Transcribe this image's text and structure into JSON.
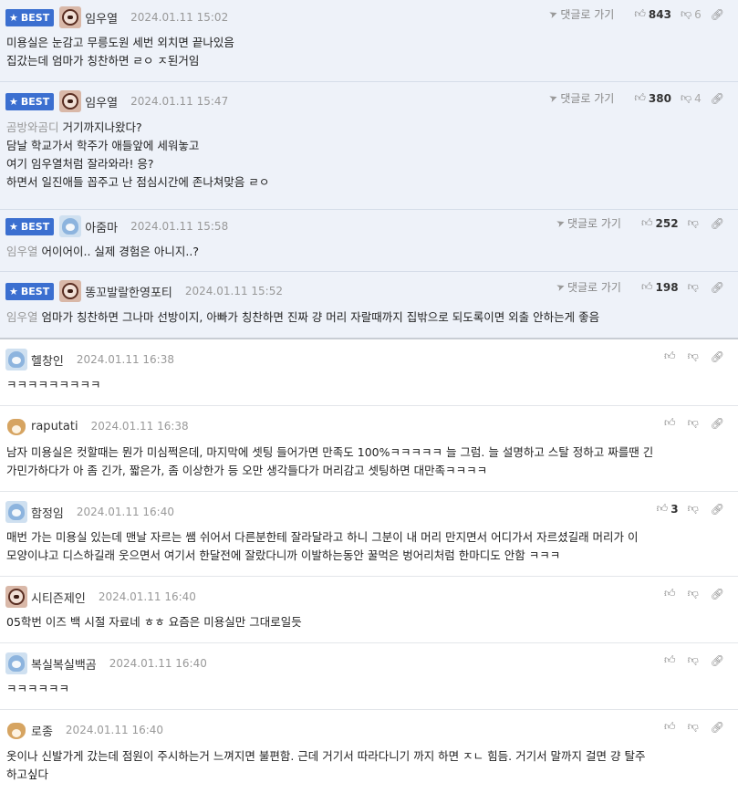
{
  "labels": {
    "best": "BEST",
    "reply": "댓글로 가기"
  },
  "comments": [
    {
      "nick": "임우열",
      "date": "2024.01.11 15:02",
      "up": "843",
      "down": "6",
      "lines": [
        "미용실은 눈감고 무릉도원 세번 외치면 끝나있음",
        "집갔는데 엄마가 칭찬하면 ㄹㅇ ㅈ된거임"
      ]
    },
    {
      "nick": "임우열",
      "date": "2024.01.11 15:47",
      "up": "380",
      "down": "4",
      "mention": "곰방와곰디",
      "lines": [
        "거기까지나왔다?",
        "담날 학교가서 학주가 애들앞에 세워놓고",
        "여기 임우열처럼 잘라와라! 응?",
        "하면서 일진애들 꼽주고 난 점심시간에 존나쳐맞음 ㄹㅇ"
      ]
    },
    {
      "nick": "아줌마",
      "date": "2024.01.11 15:58",
      "up": "252",
      "mention": "임우열",
      "lines": [
        "어이어이.. 실제 경험은 아니지..?"
      ]
    },
    {
      "nick": "똥꼬발랄한영포티",
      "date": "2024.01.11 15:52",
      "up": "198",
      "mention": "임우열",
      "lines": [
        "엄마가 칭찬하면 그나마 선방이지, 아빠가 칭찬하면 진짜 걍 머리 자랄때까지 집밖으로 되도록이면 외출 안하는게 좋음"
      ]
    },
    {
      "nick": "헬창인",
      "date": "2024.01.11 16:38",
      "lines": [
        "ㅋㅋㅋㅋㅋㅋㅋㅋㅋ"
      ]
    },
    {
      "nick": "raputati",
      "date": "2024.01.11 16:38",
      "lines": [
        "남자 미용실은 컷할때는 뭔가 미심쩍은데, 마지막에 셋팅 들어가면 만족도 100%ㅋㅋㅋㅋㅋ 늘 그럼. 늘 설명하고 스탈 정하고 짜를땐 긴",
        "가민가하다가 아 좀 긴가, 짧은가, 좀 이상한가 등 오만 생각들다가 머리감고 셋팅하면 대만족ㅋㅋㅋㅋ"
      ]
    },
    {
      "nick": "함정임",
      "date": "2024.01.11 16:40",
      "up": "3",
      "lines": [
        "매번 가는 미용실 있는데 맨날 자르는 쌤 쉬어서 다른분한테 잘라달라고 하니 그분이 내 머리 만지면서 어디가서 자르셨길래 머리가 이",
        "모양이냐고 디스하길래 웃으면서 여기서 한달전에 잘랐다니까 이발하는동안 꿀먹은 벙어리처럼 한마디도 안함 ㅋㅋㅋ"
      ]
    },
    {
      "nick": "시티즌제인",
      "date": "2024.01.11 16:40",
      "lines": [
        "05학번 이즈 백 시절 자료네 ㅎㅎ 요즘은 미용실만 그대로일듯"
      ]
    },
    {
      "nick": "복실복실백곰",
      "date": "2024.01.11 16:40",
      "lines": [
        "ㅋㅋㅋㅋㅋㅋ"
      ]
    },
    {
      "nick": "로종",
      "date": "2024.01.11 16:40",
      "lines": [
        "옷이나 신발가게 갔는데 점원이 주시하는거 느껴지면 불편함. 근데 거기서 따라다니기 까지 하면 ㅈㄴ 힘듬. 거기서 말까지 걸면 걍 탈주",
        "하고싶다"
      ]
    }
  ]
}
